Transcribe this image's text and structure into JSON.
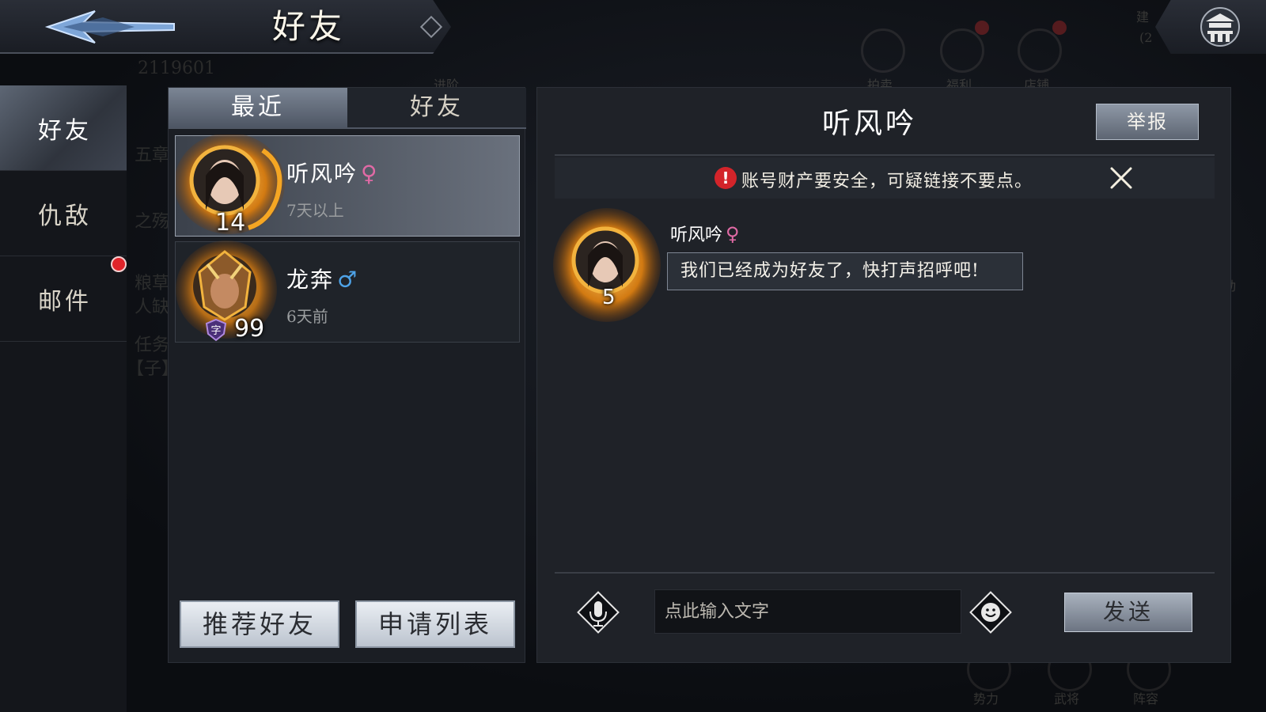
{
  "header": {
    "title": "好友"
  },
  "background": {
    "score": "2119601",
    "menu_auction": "拍卖",
    "menu_welfare": "福利",
    "menu_shop": "店铺",
    "menu_advance": "进阶",
    "menu_build": "建",
    "menu_build_count": "(2",
    "menu_event": "动",
    "menu_power": "势力",
    "menu_general": "武将",
    "menu_formation": "阵容",
    "task_1": "五章",
    "task_2": "之殇",
    "task_3": "粮草",
    "task_4": "人缺",
    "task_5": "任务",
    "task_6": "【子】"
  },
  "sidebar": {
    "items": [
      {
        "label": "好友",
        "active": true
      },
      {
        "label": "仇敌",
        "active": false
      },
      {
        "label": "邮件",
        "active": false,
        "has_notification": true
      }
    ]
  },
  "friend_list": {
    "tabs": [
      {
        "label": "最近",
        "active": true
      },
      {
        "label": "好友",
        "active": false
      }
    ],
    "friends": [
      {
        "name": "听风吟",
        "gender": "♀",
        "level": "14",
        "last_online": "7天以上",
        "selected": true
      },
      {
        "name": "龙奔",
        "gender": "♂",
        "level": "99",
        "vip_badge": "字",
        "last_online": "6天前",
        "selected": false
      }
    ],
    "buttons": {
      "recommend": "推荐好友",
      "requests": "申请列表"
    }
  },
  "chat": {
    "title": "听风吟",
    "report_label": "举报",
    "notice": {
      "icon": "!",
      "text": "账号财产要安全，可疑链接不要点。"
    },
    "messages": [
      {
        "sender": "听风吟",
        "gender": "♀",
        "level": "5",
        "text": "我们已经成为好友了，快打声招呼吧!"
      }
    ],
    "input_placeholder": "点此输入文字",
    "send_label": "发送"
  },
  "colors": {
    "accent_red": "#e0242a",
    "female": "#e06aa5",
    "male": "#4ea3e8",
    "panel": "#1f2228"
  },
  "icons": {
    "back": "back-arrow-icon",
    "home": "home-pagoda-icon",
    "voice": "microphone-icon",
    "emoji": "smiley-icon",
    "close": "close-x-icon",
    "warning": "exclamation-icon"
  }
}
